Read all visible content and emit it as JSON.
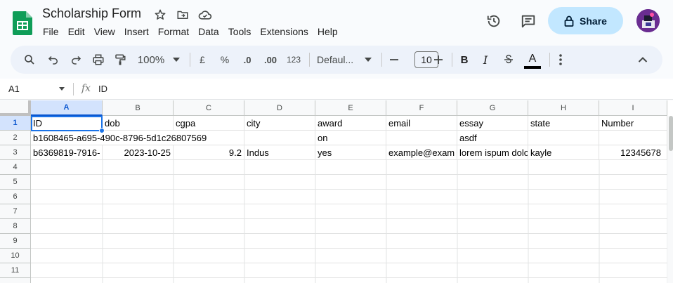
{
  "doc": {
    "title": "Scholarship Form"
  },
  "menu": [
    "File",
    "Edit",
    "View",
    "Insert",
    "Format",
    "Data",
    "Tools",
    "Extensions",
    "Help"
  ],
  "share": {
    "label": "Share"
  },
  "toolbar": {
    "zoom": "100%",
    "currency": "£",
    "percent": "%",
    "dec_decrease": ".0",
    "dec_increase": ".00",
    "number_format": "123",
    "font": "Defaul...",
    "font_size": "10",
    "bold": "B",
    "italic": "I",
    "text_color": "A"
  },
  "formula_bar": {
    "cell_ref": "A1",
    "fx": "fx",
    "value": "ID"
  },
  "columns": [
    "A",
    "B",
    "C",
    "D",
    "E",
    "F",
    "G",
    "H",
    "I"
  ],
  "rows": [
    "1",
    "2",
    "3",
    "4",
    "5",
    "6",
    "7",
    "8",
    "9",
    "10",
    "11"
  ],
  "cells": {
    "r1": [
      "ID",
      "dob",
      "cgpa",
      "city",
      "award",
      "email",
      "essay",
      "state",
      "Number"
    ],
    "r2": [
      "b1608465-a695-490c-8796-5d1c26807569",
      "",
      "",
      "",
      "on",
      "",
      "asdf",
      "",
      ""
    ],
    "r3": [
      "b6369819-7916-",
      "2023-10-25",
      "9.2",
      "Indus",
      "yes",
      "example@exam",
      "lorem ispum dolo",
      "kayle",
      "12345678"
    ]
  },
  "colors": {
    "accent": "#1a73e8",
    "share_bg": "#c2e7ff",
    "sheets_green": "#0f9d58"
  }
}
